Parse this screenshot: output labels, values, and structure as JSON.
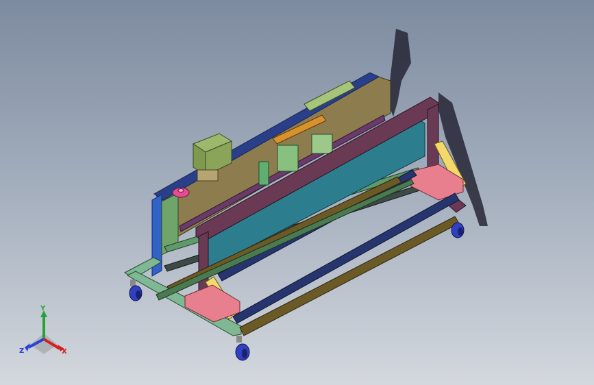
{
  "viewport": {
    "content": "isometric-3d-model",
    "model_icon": "machine-frame-assembly"
  },
  "triad": {
    "x_label": "X",
    "y_label": "Y",
    "z_label": "Z",
    "colors": {
      "x": "#d42020",
      "y": "#27a23b",
      "z": "#2a3fd6"
    }
  },
  "palette": {
    "background_top": "#7d8ba0",
    "background_bottom": "#d4d8de",
    "frame_green": "#7fb893",
    "frame_pink": "#e87f8e",
    "beam_navy": "#27356e",
    "beam_brown": "#6b5a26",
    "panel_teal": "#2c7e8e",
    "header_plum": "#6a3a55",
    "brace_yellow": "#f2d96a",
    "housing_tan": "#8d7d4e",
    "motor_olive": "#8aa45a",
    "caster_blue": "#3040c0"
  }
}
